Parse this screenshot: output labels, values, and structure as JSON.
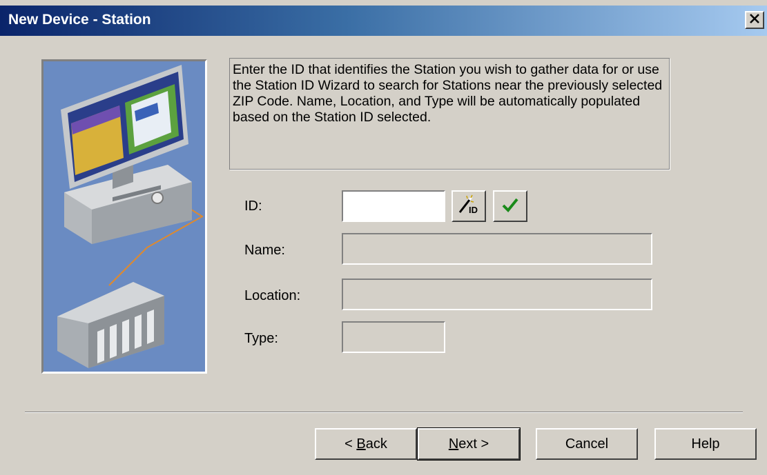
{
  "window": {
    "title": "New Device - Station",
    "close_glyph": "✕"
  },
  "description": "Enter the ID that identifies the Station you wish to gather data for or use the Station ID Wizard to search for Stations near the previously selected ZIP Code.  Name, Location, and Type will be automatically populated based on the Station ID selected.",
  "form": {
    "id_label": "ID:",
    "id_value": "",
    "name_label": "Name:",
    "name_value": "",
    "location_label": "Location:",
    "location_value": "",
    "type_label": "Type:",
    "type_value": "",
    "wizard_icon_text": "ID"
  },
  "buttons": {
    "back_prefix": "< ",
    "back_mnemonic": "B",
    "back_rest": "ack",
    "next_mnemonic": "N",
    "next_rest": "ext >",
    "cancel": "Cancel",
    "help": "Help"
  },
  "icons": {
    "wizard": "magic-wand-id-icon",
    "validate": "checkmark-icon",
    "illustration": "computer-plc-illustration"
  },
  "colors": {
    "title_start": "#0a246a",
    "title_end": "#a6caf0",
    "illustration_bg": "#6a8bc2",
    "check_green": "#1a8a1a"
  }
}
